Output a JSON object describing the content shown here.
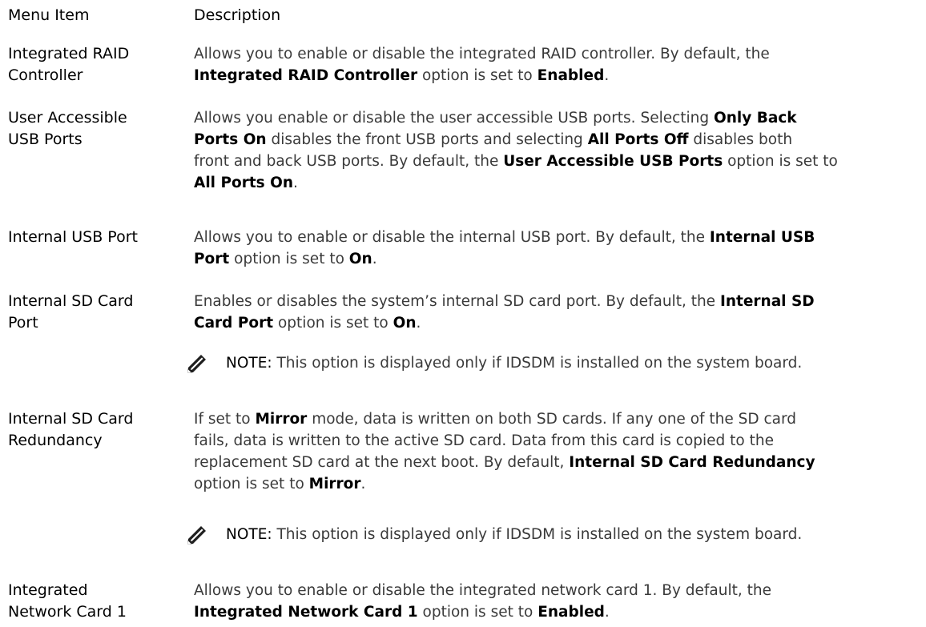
{
  "header": {
    "menu_item": "Menu Item",
    "description": "Description"
  },
  "rows": [
    {
      "term": [
        "Integrated RAID",
        "Controller"
      ],
      "desc": [
        "Allows you to enable or disable the integrated RAID controller. By default, the",
        [
          "Integrated RAID Controller",
          " option is set to ",
          "Enabled",
          "."
        ]
      ]
    },
    {
      "term": [
        "User Accessible",
        "USB Ports"
      ],
      "desc": [
        [
          "Allows you enable or disable the user accessible USB ports. Selecting ",
          "Only Back"
        ],
        [
          "Ports On",
          " disables the front USB ports and selecting ",
          "All Ports Off",
          " disables both"
        ],
        [
          "front and back USB ports. By default, the ",
          "User Accessible USB Ports",
          " option is set to"
        ],
        [
          "All Ports On",
          "."
        ]
      ]
    },
    {
      "term": [
        "Internal USB Port"
      ],
      "desc": [
        [
          "Allows you to enable or disable the internal USB port. By default, the ",
          "Internal USB"
        ],
        [
          "Port",
          " option is set to ",
          "On",
          "."
        ]
      ]
    },
    {
      "term": [
        "Internal SD Card",
        "Port"
      ],
      "desc": [
        [
          "Enables or disables the system’s internal SD card port. By default, the ",
          "Internal SD"
        ],
        [
          "Card Port",
          " option is set to ",
          "On",
          "."
        ]
      ]
    },
    {
      "term": [
        "Internal SD Card",
        "Redundancy"
      ],
      "desc": [
        [
          "If set to ",
          "Mirror",
          " mode, data is written on both SD cards. If any one of the SD card"
        ],
        "fails, data is written to the active SD card. Data from this card is copied to the",
        [
          "replacement SD card at the next boot. By default, ",
          "Internal SD Card Redundancy"
        ],
        [
          "option is set to ",
          "Mirror",
          "."
        ]
      ]
    },
    {
      "term": [
        "Integrated",
        "Network Card 1"
      ],
      "desc": [
        "Allows you to enable or disable the integrated network card 1. By default, the",
        [
          "Integrated Network Card 1",
          " option is set to ",
          "Enabled",
          "."
        ]
      ]
    }
  ],
  "notes": {
    "label": "NOTE:",
    "text": " This option is displayed only if IDSDM is installed on the system board.",
    "icon": "pencil-note-icon"
  }
}
